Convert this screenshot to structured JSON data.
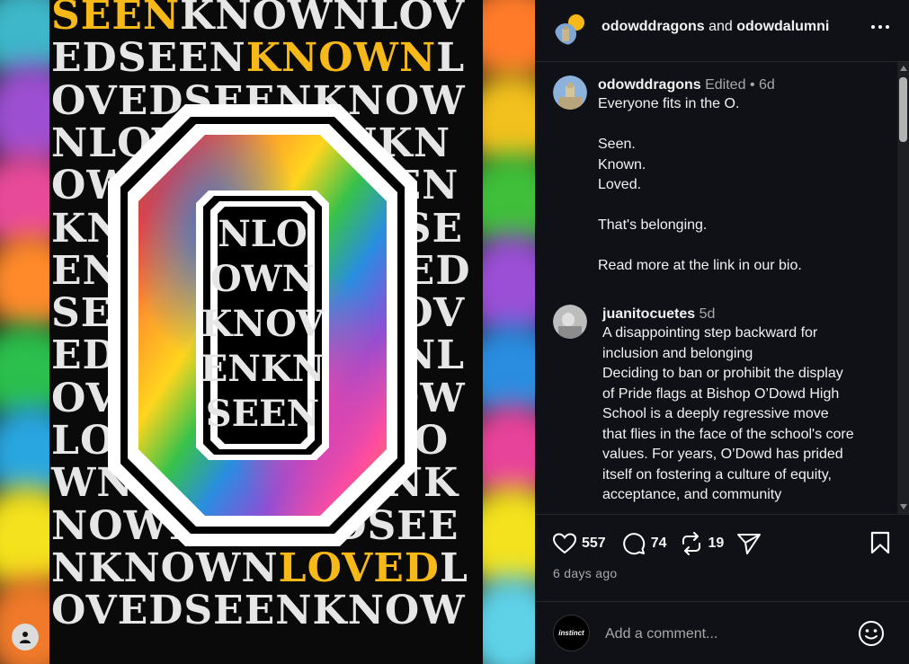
{
  "poster": {
    "lines": [
      {
        "y": "SEEN",
        "w": "KNOWNLOV"
      },
      {
        "w": "EDSEEN",
        "y": "KNOWN",
        "w2": "L"
      },
      {
        "w": "OVEDSEENKNOW"
      },
      {
        "w": "NLOVEDSEENKN"
      },
      {
        "w": "OWNLOVEDSEEN"
      },
      {
        "w": "KNOWNLOVEDSE"
      },
      {
        "w": "ENKNOWNLOVED"
      },
      {
        "w": "SEENKNOWNLOV"
      },
      {
        "w": "EDSEENKNOWNL"
      },
      {
        "w": "OVEDSEENKNOW"
      },
      {
        "w": "LOVEDSEENKNO"
      },
      {
        "w": "WNLOVEDSEENK"
      },
      {
        "w": "NOWNLOVEDSEE"
      },
      {
        "w": "NKNOWN",
        "y": "LOVED",
        "w2": "L"
      },
      {
        "w": "OVEDSEENKNOW"
      }
    ],
    "inner_words": [
      "NLO",
      "OWN",
      "KNOV",
      "ENKN",
      "SEEN"
    ],
    "colors": {
      "yellow": "#f6b917",
      "white_text": "#e6e6e6",
      "background": "#0a0a0a"
    }
  },
  "header": {
    "account1": "odowddragons",
    "conjunction": " and ",
    "account2": "odowdalumni",
    "more_icon": "more-horizontal-icon"
  },
  "caption": {
    "username": "odowddragons",
    "edited": "Edited",
    "dot": "•",
    "time": "6d",
    "text": "Everyone fits in the O.\n\nSeen.\nKnown.\nLoved.\n\nThat's belonging.\n\nRead more at the link in our bio."
  },
  "comments": [
    {
      "username": "juanitocuetes",
      "time": "5d",
      "text": "A disappointing step backward for inclusion and belonging\nDeciding to ban or prohibit the display of Pride flags at Bishop O’Dowd High School is a deeply regressive move that flies in the face of the school's core values. For years, O’Dowd has prided itself on fostering a culture of equity, acceptance, and community"
    }
  ],
  "actions": {
    "likes": "557",
    "comments": "74",
    "reposts": "19"
  },
  "timeago": "6 days ago",
  "comment_box": {
    "placeholder": "Add a comment...",
    "avatar_text": "instinct"
  }
}
